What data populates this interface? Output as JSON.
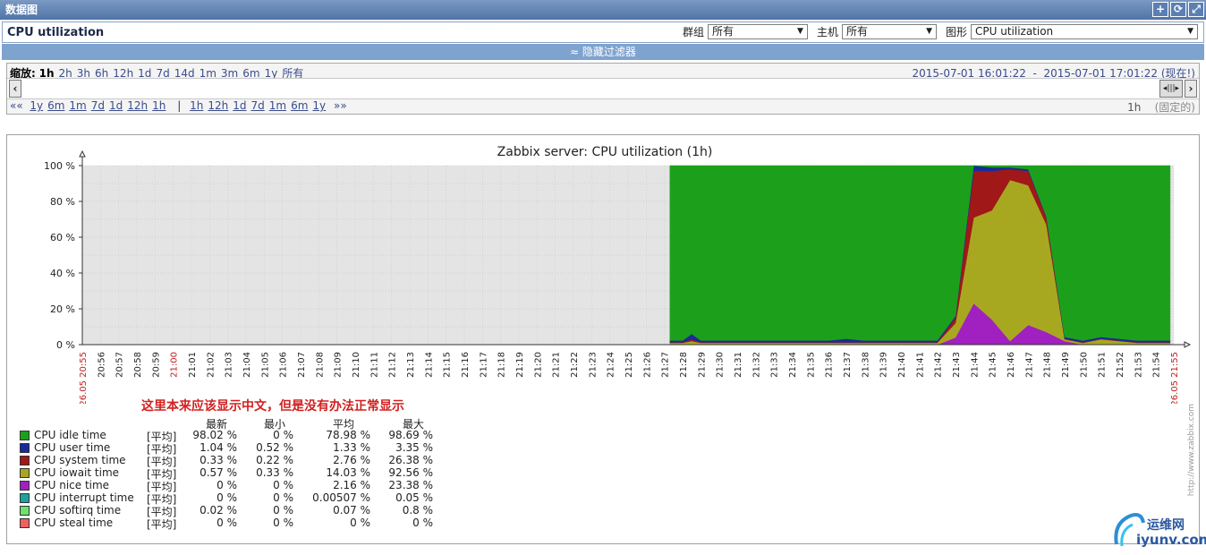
{
  "window": {
    "title": "数据图"
  },
  "header": {
    "page_title": "CPU utilization",
    "group_label": "群组",
    "group_value": "所有",
    "host_label": "主机",
    "host_value": "所有",
    "graph_label": "图形",
    "graph_value": "CPU utilization"
  },
  "filter_toggle": "≈ 隐藏过滤器",
  "zoom": {
    "label": "缩放:",
    "options": [
      "1h",
      "2h",
      "3h",
      "6h",
      "12h",
      "1d",
      "7d",
      "14d",
      "1m",
      "3m",
      "6m",
      "1y",
      "所有"
    ],
    "period_from": "2015-07-01 16:01:22",
    "period_dash": "-",
    "period_to": "2015-07-01 17:01:22",
    "now_link": "(现在!)"
  },
  "nav": {
    "back_prefix": "««",
    "back_options": [
      "1y",
      "6m",
      "1m",
      "7d",
      "1d",
      "12h",
      "1h"
    ],
    "divider": "|",
    "fwd_options": [
      "1h",
      "12h",
      "1d",
      "7d",
      "1m",
      "6m",
      "1y"
    ],
    "fwd_suffix": "»»",
    "period_label": "1h",
    "fixed_label": "(固定的)"
  },
  "graph": {
    "title": "Zabbix server: CPU utilization (1h)",
    "start_label": "26.05 20:55",
    "end_label": "26.05 21:55",
    "watermark": "http://www.zabbix.com"
  },
  "chart_data": {
    "type": "area",
    "title": "Zabbix server: CPU utilization (1h)",
    "y_ticks": [
      "0 %",
      "20 %",
      "40 %",
      "60 %",
      "80 %",
      "100 %"
    ],
    "ylim": [
      0,
      100
    ],
    "x_ticks": [
      "20:56",
      "20:57",
      "20:58",
      "20:59",
      "21:00",
      "21:01",
      "21:02",
      "21:03",
      "21:04",
      "21:05",
      "21:06",
      "21:07",
      "21:08",
      "21:09",
      "21:10",
      "21:11",
      "21:12",
      "21:13",
      "21:14",
      "21:15",
      "21:16",
      "21:17",
      "21:18",
      "21:19",
      "21:20",
      "21:21",
      "21:22",
      "21:23",
      "21:24",
      "21:25",
      "21:26",
      "21:27",
      "21:28",
      "21:29",
      "21:30",
      "21:31",
      "21:32",
      "21:33",
      "21:34",
      "21:35",
      "21:36",
      "21:37",
      "21:38",
      "21:39",
      "21:40",
      "21:41",
      "21:42",
      "21:43",
      "21:44",
      "21:45",
      "21:46",
      "21:47",
      "21:48",
      "21:49",
      "21:50",
      "21:51",
      "21:52",
      "21:53",
      "21:54"
    ],
    "stacked": true,
    "x_minutes": [
      32.3,
      33,
      33.5,
      34,
      35,
      36,
      37,
      38,
      39,
      40,
      41,
      42,
      43,
      44,
      45,
      46,
      47,
      48,
      49,
      50,
      51,
      52,
      53,
      54,
      55,
      56,
      57,
      58,
      59,
      59.8
    ],
    "series": [
      {
        "name": "CPU nice time",
        "color": "#a020c0",
        "values": [
          0,
          0,
          0,
          0,
          0,
          0,
          0,
          0,
          0,
          0,
          0,
          0,
          0,
          0,
          0,
          0,
          0,
          4,
          23,
          14,
          2,
          11,
          7,
          2,
          0,
          0,
          0,
          0,
          0,
          0
        ]
      },
      {
        "name": "CPU iowait time",
        "color": "#a8a820",
        "values": [
          1,
          1,
          2,
          1,
          1,
          1,
          1,
          1,
          1,
          1,
          1,
          1,
          1,
          1,
          1,
          1,
          1,
          8,
          48,
          61,
          90,
          78,
          60,
          1,
          1,
          3,
          2,
          1,
          1,
          1
        ]
      },
      {
        "name": "CPU system time",
        "color": "#a01818",
        "values": [
          0.3,
          0.3,
          1,
          0.3,
          0.3,
          0.3,
          0.3,
          0.3,
          0.3,
          0.3,
          0.3,
          0.3,
          0.3,
          0.3,
          0.3,
          0.3,
          0.3,
          3,
          26,
          22,
          6,
          8,
          4,
          0.3,
          0.3,
          0.3,
          0.3,
          0.3,
          0.3,
          0.3
        ]
      },
      {
        "name": "CPU user time",
        "color": "#1a2a9a",
        "values": [
          1,
          1,
          3,
          1,
          1,
          1,
          1,
          1,
          1,
          1,
          1,
          2,
          1,
          1,
          1,
          1,
          1,
          1,
          3,
          2,
          1,
          1,
          0.5,
          1,
          1,
          1,
          1,
          1,
          1,
          1
        ]
      },
      {
        "name": "CPU idle time",
        "color": "#1ca01c",
        "values": [
          97.7,
          97.7,
          94,
          97.7,
          97.7,
          97.7,
          97.7,
          97.7,
          97.7,
          97.7,
          97.7,
          96.7,
          97.7,
          97.7,
          97.7,
          97.7,
          97.7,
          84,
          0,
          1,
          1,
          2,
          28.5,
          95.7,
          97.7,
          95.7,
          96.7,
          97.7,
          97.7,
          97.7
        ]
      }
    ]
  },
  "note": "这里本来应该显示中文，但是没有办法正常显示",
  "legend": {
    "headers": [
      "最新",
      "最小",
      "平均",
      "最大"
    ],
    "rows": [
      {
        "name": "CPU idle time",
        "color": "#1ca01c",
        "fn": "[平均]",
        "last": "98.02 %",
        "min": "0 %",
        "avg": "78.98 %",
        "max": "98.69 %"
      },
      {
        "name": "CPU user time",
        "color": "#1a2a9a",
        "fn": "[平均]",
        "last": "1.04 %",
        "min": "0.52 %",
        "avg": "1.33 %",
        "max": "3.35 %"
      },
      {
        "name": "CPU system time",
        "color": "#a01818",
        "fn": "[平均]",
        "last": "0.33 %",
        "min": "0.22 %",
        "avg": "2.76 %",
        "max": "26.38 %"
      },
      {
        "name": "CPU iowait time",
        "color": "#a8a820",
        "fn": "[平均]",
        "last": "0.57 %",
        "min": "0.33 %",
        "avg": "14.03 %",
        "max": "92.56 %"
      },
      {
        "name": "CPU nice time",
        "color": "#a020c0",
        "fn": "[平均]",
        "last": "0 %",
        "min": "0 %",
        "avg": "2.16 %",
        "max": "23.38 %"
      },
      {
        "name": "CPU interrupt time",
        "color": "#20a0a0",
        "fn": "[平均]",
        "last": "0 %",
        "min": "0 %",
        "avg": "0.00507 %",
        "max": "0.05 %"
      },
      {
        "name": "CPU softirq time",
        "color": "#70e070",
        "fn": "[平均]",
        "last": "0.02 %",
        "min": "0 %",
        "avg": "0.07 %",
        "max": "0.8 %"
      },
      {
        "name": "CPU steal time",
        "color": "#f06060",
        "fn": "[平均]",
        "last": "0 %",
        "min": "0 %",
        "avg": "0 %",
        "max": "0 %"
      }
    ]
  },
  "logo": {
    "text_cn": "运维网",
    "text_en": "iyunv.com"
  }
}
